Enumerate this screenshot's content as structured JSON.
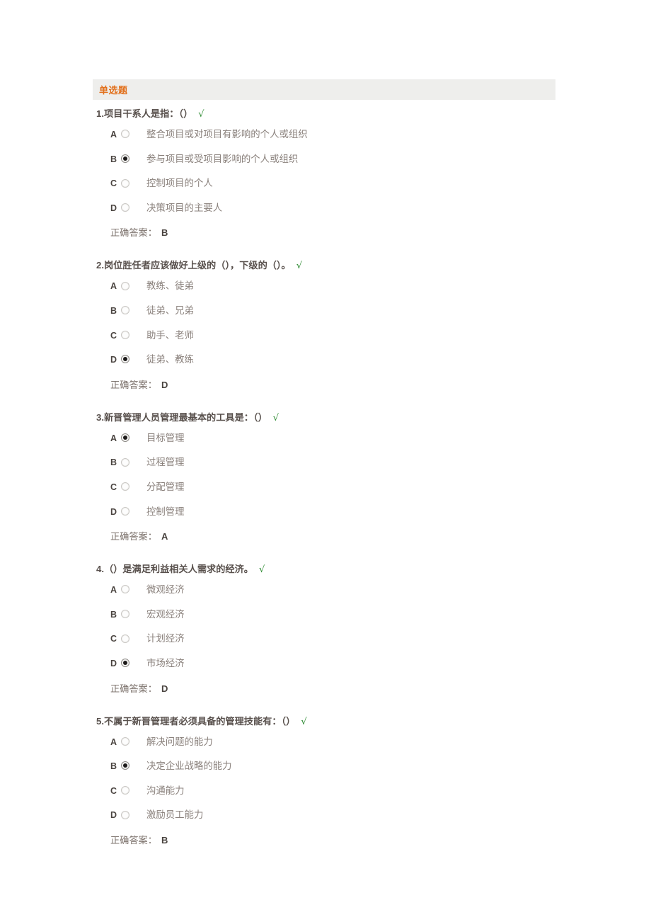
{
  "section": {
    "title": "单选题",
    "accent_color": "#e2711d",
    "background_color": "#eeeeec"
  },
  "labels": {
    "answer_label": "正确答案：",
    "check_mark": "√",
    "check_color": "#2d8b32"
  },
  "questions": [
    {
      "index": "1.",
      "stem": "项目干系人是指：（）",
      "marked_correct": "√",
      "options": [
        {
          "letter": "A",
          "text": "整合项目或对项目有影响的个人或组织",
          "selected": false
        },
        {
          "letter": "B",
          "text": "参与项目或受项目影响的个人或组织",
          "selected": true
        },
        {
          "letter": "C",
          "text": "控制项目的个人",
          "selected": false
        },
        {
          "letter": "D",
          "text": "决策项目的主要人",
          "selected": false
        }
      ],
      "answer_label": "正确答案：",
      "answer": "B"
    },
    {
      "index": "2.",
      "stem": "岗位胜任者应该做好上级的（），下级的（）。",
      "marked_correct": "√",
      "options": [
        {
          "letter": "A",
          "text": "教练、徒弟",
          "selected": false
        },
        {
          "letter": "B",
          "text": "徒弟、兄弟",
          "selected": false
        },
        {
          "letter": "C",
          "text": "助手、老师",
          "selected": false
        },
        {
          "letter": "D",
          "text": "徒弟、教练",
          "selected": true
        }
      ],
      "answer_label": "正确答案：",
      "answer": "D"
    },
    {
      "index": "3.",
      "stem": "新晋管理人员管理最基本的工具是：（）",
      "marked_correct": "√",
      "options": [
        {
          "letter": "A",
          "text": "目标管理",
          "selected": true
        },
        {
          "letter": "B",
          "text": "过程管理",
          "selected": false
        },
        {
          "letter": "C",
          "text": "分配管理",
          "selected": false
        },
        {
          "letter": "D",
          "text": "控制管理",
          "selected": false
        }
      ],
      "answer_label": "正确答案：",
      "answer": "A"
    },
    {
      "index": "4.",
      "stem": "（）是满足利益相关人需求的经济。",
      "marked_correct": "√",
      "options": [
        {
          "letter": "A",
          "text": "微观经济",
          "selected": false
        },
        {
          "letter": "B",
          "text": "宏观经济",
          "selected": false
        },
        {
          "letter": "C",
          "text": "计划经济",
          "selected": false
        },
        {
          "letter": "D",
          "text": "市场经济",
          "selected": true
        }
      ],
      "answer_label": "正确答案：",
      "answer": "D"
    },
    {
      "index": "5.",
      "stem": "不属于新晋管理者必须具备的管理技能有：（）",
      "marked_correct": "√",
      "options": [
        {
          "letter": "A",
          "text": "解决问题的能力",
          "selected": false
        },
        {
          "letter": "B",
          "text": "决定企业战略的能力",
          "selected": true
        },
        {
          "letter": "C",
          "text": "沟通能力",
          "selected": false
        },
        {
          "letter": "D",
          "text": "激励员工能力",
          "selected": false
        }
      ],
      "answer_label": "正确答案：",
      "answer": "B"
    }
  ]
}
